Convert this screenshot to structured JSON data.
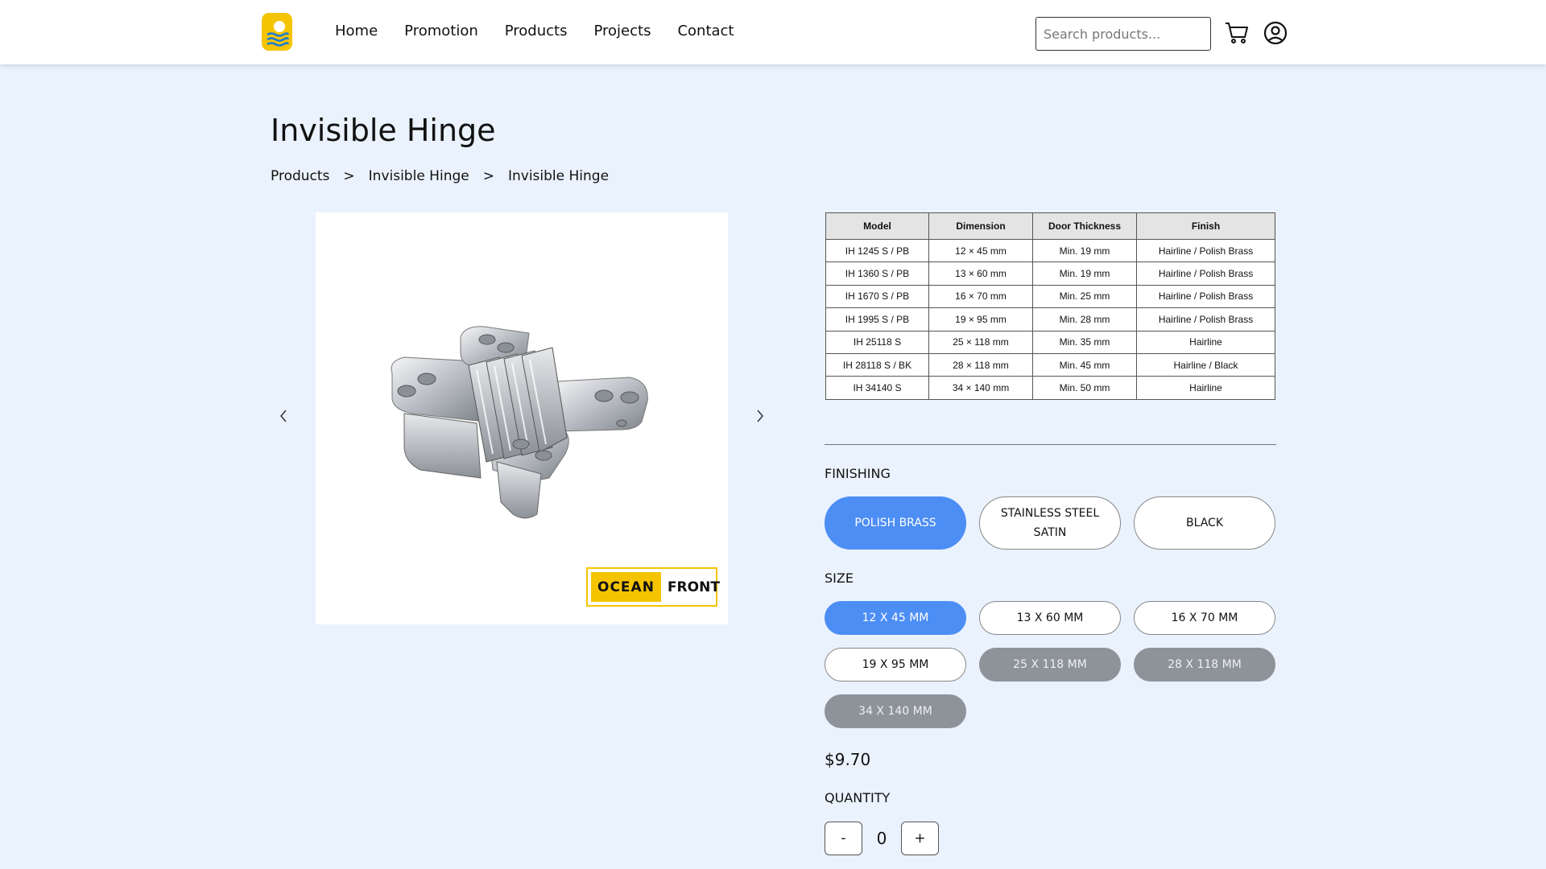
{
  "nav": {
    "items": [
      "Home",
      "Promotion",
      "Products",
      "Projects",
      "Contact"
    ]
  },
  "search": {
    "placeholder": "Search products...",
    "value": ""
  },
  "icons": {
    "cart": "shopping-cart-icon",
    "account": "user-circle-icon"
  },
  "page": {
    "title": "Invisible Hinge"
  },
  "breadcrumb": [
    "Products",
    "Invisible Hinge",
    "Invisible Hinge"
  ],
  "breadcrumb_separator": ">",
  "brand": {
    "part1": "OCEAN",
    "part2": "FRONT"
  },
  "spec_table": {
    "headers": [
      "Model",
      "Dimension",
      "Door Thickness",
      "Finish"
    ],
    "rows": [
      [
        "IH 1245 S / PB",
        "12 × 45 mm",
        "Min. 19 mm",
        "Hairline / Polish Brass"
      ],
      [
        "IH 1360 S / PB",
        "13 × 60 mm",
        "Min. 19 mm",
        "Hairline / Polish Brass"
      ],
      [
        "IH 1670 S / PB",
        "16 × 70 mm",
        "Min. 25 mm",
        "Hairline / Polish Brass"
      ],
      [
        "IH 1995 S / PB",
        "19 × 95 mm",
        "Min. 28 mm",
        "Hairline / Polish Brass"
      ],
      [
        "IH 25118 S",
        "25 × 118 mm",
        "Min. 35 mm",
        "Hairline"
      ],
      [
        "IH 28118 S / BK",
        "28 × 118 mm",
        "Min. 45 mm",
        "Hairline / Black"
      ],
      [
        "IH 34140 S",
        "34 × 140 mm",
        "Min. 50 mm",
        "Hairline"
      ]
    ]
  },
  "finishing": {
    "label": "FINISHING",
    "options": [
      {
        "label": "POLISH BRASS",
        "state": "selected"
      },
      {
        "label": "STAINLESS STEEL SATIN",
        "state": "available"
      },
      {
        "label": "BLACK",
        "state": "available"
      }
    ]
  },
  "size": {
    "label": "SIZE",
    "options": [
      {
        "label": "12 X 45 MM",
        "state": "selected"
      },
      {
        "label": "13 X 60 MM",
        "state": "available"
      },
      {
        "label": "16 X 70 MM",
        "state": "available"
      },
      {
        "label": "19 X 95 MM",
        "state": "available"
      },
      {
        "label": "25 X 118 MM",
        "state": "disabled"
      },
      {
        "label": "28 X 118 MM",
        "state": "disabled"
      },
      {
        "label": "34 X 140 MM",
        "state": "disabled"
      }
    ]
  },
  "price": "$9.70",
  "quantity": {
    "label": "QUANTITY",
    "value": "0",
    "minus": "-",
    "plus": "+"
  },
  "colors": {
    "accent": "#4d8ef5",
    "background": "#eaf2fd",
    "disabled": "#8e939a",
    "brand_yellow": "#f5c400"
  }
}
